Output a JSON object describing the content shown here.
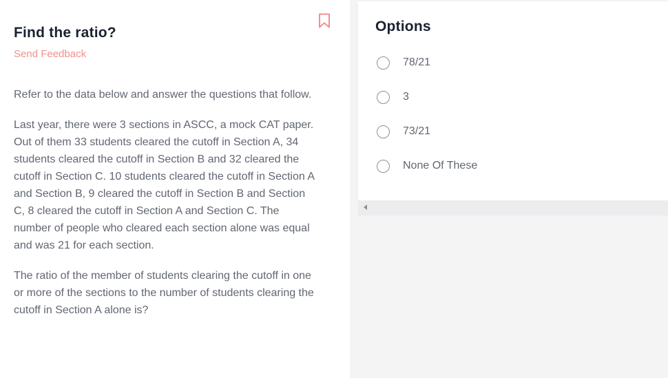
{
  "question": {
    "title": "Find the ratio?",
    "feedback_link": "Send Feedback",
    "bookmark_icon": "bookmark-icon",
    "paragraphs": [
      "Refer to the data below and answer the questions that follow.",
      "Last year, there were 3 sections in ASCC, a mock CAT paper. Out of them 33 students cleared the cutoff in Section A, 34 students cleared the cutoff in Section B and 32 cleared the cutoff in Section C. 10 students cleared the cutoff in Section A and Section B, 9 cleared the cutoff in Section B and Section C, 8 cleared the cutoff in Section A and Section C. The number of people who cleared each section alone was equal and was 21 for each section.",
      "The ratio of the member of students clearing the cutoff in one or more of the sections to the number of students clearing the cutoff in Section A alone is?"
    ]
  },
  "options": {
    "heading": "Options",
    "items": [
      {
        "label": "78/21"
      },
      {
        "label": "3"
      },
      {
        "label": "73/21"
      },
      {
        "label": "None Of These"
      }
    ]
  },
  "scrollbar": {
    "left_arrow_icon": "scroll-left-arrow-icon"
  },
  "colors": {
    "accent": "#f0908b",
    "heading": "#1b2130",
    "body_text": "#616671",
    "background": "#f4f4f5"
  }
}
